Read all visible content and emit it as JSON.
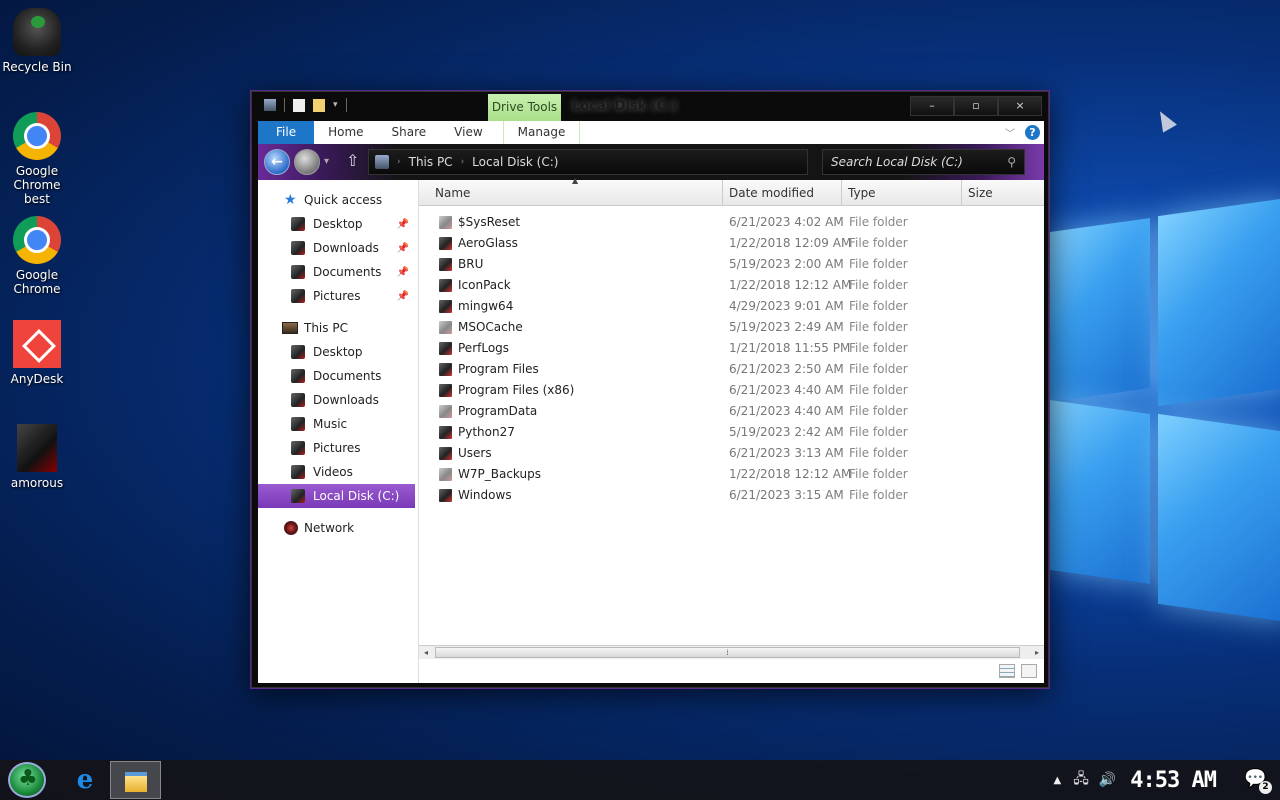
{
  "desktop": {
    "icons": [
      {
        "label": "Recycle Bin"
      },
      {
        "label": "Google Chrome best"
      },
      {
        "label": "Google Chrome"
      },
      {
        "label": "AnyDesk"
      },
      {
        "label": "amorous"
      }
    ]
  },
  "window": {
    "title": "Local Disk (C:)",
    "context_tab": "Drive Tools",
    "buttons": {
      "minimize": "–",
      "maximize": "▫",
      "close": "×"
    },
    "ribbon_tabs": [
      "File",
      "Home",
      "Share",
      "View",
      "Manage"
    ],
    "help": "?",
    "address": {
      "segments": [
        "This PC",
        "Local Disk (C:)"
      ]
    },
    "search_placeholder": "Search Local Disk (C:)"
  },
  "sidebar": {
    "quick_access": "Quick access",
    "quick_items": [
      "Desktop",
      "Downloads",
      "Documents",
      "Pictures"
    ],
    "this_pc": "This PC",
    "pc_items": [
      "Desktop",
      "Documents",
      "Downloads",
      "Music",
      "Pictures",
      "Videos",
      "Local Disk (C:)"
    ],
    "network": "Network"
  },
  "columns": {
    "name": "Name",
    "date": "Date modified",
    "type": "Type",
    "size": "Size"
  },
  "files": [
    {
      "name": "$SysReset",
      "date": "6/21/2023 4:02 AM",
      "type": "File folder",
      "light": true
    },
    {
      "name": "AeroGlass",
      "date": "1/22/2018 12:09 AM",
      "type": "File folder",
      "light": false
    },
    {
      "name": "BRU",
      "date": "5/19/2023 2:00 AM",
      "type": "File folder",
      "light": false
    },
    {
      "name": "IconPack",
      "date": "1/22/2018 12:12 AM",
      "type": "File folder",
      "light": false
    },
    {
      "name": "mingw64",
      "date": "4/29/2023 9:01 AM",
      "type": "File folder",
      "light": false
    },
    {
      "name": "MSOCache",
      "date": "5/19/2023 2:49 AM",
      "type": "File folder",
      "light": true
    },
    {
      "name": "PerfLogs",
      "date": "1/21/2018 11:55 PM",
      "type": "File folder",
      "light": false
    },
    {
      "name": "Program Files",
      "date": "6/21/2023 2:50 AM",
      "type": "File folder",
      "light": false
    },
    {
      "name": "Program Files (x86)",
      "date": "6/21/2023 4:40 AM",
      "type": "File folder",
      "light": false
    },
    {
      "name": "ProgramData",
      "date": "6/21/2023 4:40 AM",
      "type": "File folder",
      "light": true
    },
    {
      "name": "Python27",
      "date": "5/19/2023 2:42 AM",
      "type": "File folder",
      "light": false
    },
    {
      "name": "Users",
      "date": "6/21/2023 3:13 AM",
      "type": "File folder",
      "light": false
    },
    {
      "name": "W7P_Backups",
      "date": "1/22/2018 12:12 AM",
      "type": "File folder",
      "light": true
    },
    {
      "name": "Windows",
      "date": "6/21/2023 3:15 AM",
      "type": "File folder",
      "light": false
    }
  ],
  "taskbar": {
    "clock": "4:53 AM",
    "notification_count": "2",
    "edge_glyph": "e"
  }
}
